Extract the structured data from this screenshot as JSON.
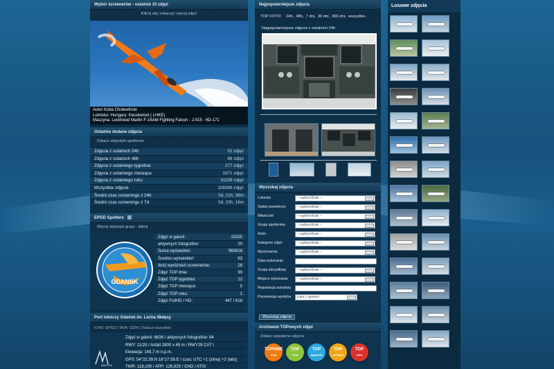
{
  "left_column": {
    "header": "Wybór screenerów - ostatnie 10 zdjęć",
    "sub": "Kliknij aby zobaczyć więcej zdjęć",
    "caption": {
      "author": "Autor Kuba Cholewiński",
      "airport": "Lotnisko: Hungary: Kecskemet ( LHKE)",
      "aircraft": "Maszyna: Lockheed Martin F-16AM Fighting Falcon - J-015 - 6D-171"
    },
    "stats": {
      "header": "Ostatnio dodane zdjęcia",
      "sub": "Zobacz statystyki spotterów",
      "rows": [
        {
          "label": "Zdjęcia z ostatnich 24h",
          "value": "52 zdjęć"
        },
        {
          "label": "Zdjęcia z ostatnich 48h",
          "value": "86 zdjęć"
        },
        {
          "label": "Zdjęcia z ostatniego tygodnia",
          "value": "277 zdjęć"
        },
        {
          "label": "Zdjęcia z ostatniego miesiąca",
          "value": "1871 zdjęć"
        },
        {
          "label": "Zdjęcia z ostatniego roku",
          "value": "31159 zdjęć"
        },
        {
          "label": "Wszystkie zdjęcia",
          "value": "108396 zdjęć"
        },
        {
          "label": "Średni czas screeningu z 24h",
          "value": "0d, 21h, 38m"
        },
        {
          "label": "Średni czas screeningu z 7d",
          "value": "0d, 23h, 16m"
        }
      ]
    },
    "spotters": {
      "header": "EPGD Spotters",
      "sub": "Więcej statystyk grupy - kliknij",
      "logo_text": "GDANSK",
      "rows": [
        {
          "label": "Zdjęć w galerii:",
          "value": "15325"
        },
        {
          "label": "aktywnych fotografów:",
          "value": "20"
        },
        {
          "label": "Suma wyświetleń:",
          "value": "960816"
        },
        {
          "label": "Średnio wyświetleń:",
          "value": "63"
        },
        {
          "label": "Ilość wyróżnień screenerów:",
          "value": "28"
        },
        {
          "label": "Zdjęć TOP dnia:",
          "value": "93"
        },
        {
          "label": "Zdjęć TOP tygodnia:",
          "value": "12"
        },
        {
          "label": "Zdjęć TOP miesiąca:",
          "value": "5"
        },
        {
          "label": "Zdjęć TOP roku:",
          "value": "1"
        },
        {
          "label": "Zdjęć FullHD / HD:",
          "value": "447 / 618"
        }
      ]
    },
    "airport": {
      "header": "Port lotniczy Gdańsk im. Lecha Wałęsy",
      "sub": "ICAO: EPGD / IATA: GDN | Zobacz wszystkie",
      "lines": [
        "Zdjęć w galerii: 6636 / aktywnych fotografów: 94",
        "RWY: 11/29 / Asfalt 2800 x 45 m / RWY29 CAT I",
        "Elewacja: 148,7 m n.p.m.",
        "GPS: 54°22.39.N 18°27.58.E / czas: UTC +1 (zima) +2 (lato)",
        "TWR: 118,100 / APP: 128,825 / GND / ATIS:"
      ],
      "logo_text": "WALESA"
    }
  },
  "middle_column": {
    "top_foto": {
      "label": "TOP FOTO:",
      "periods": [
        "24h,",
        "48h,",
        "7 dni,",
        "30 dni,",
        "365 dni,",
        "wszystkie."
      ]
    },
    "most_viewed_title": "Najpopularniejsze zdjęcia z ostatnich 24h",
    "search": {
      "header": "Wyszukaj zdjęcia",
      "placeholder": "-- wybierz/brak --",
      "fields": [
        {
          "label": "Lotnisko",
          "type": "select"
        },
        {
          "label": "Statek powietrzny",
          "type": "select"
        },
        {
          "label": "Właściciel",
          "type": "select"
        },
        {
          "label": "Grupa spotterska",
          "type": "select"
        },
        {
          "label": "Autor",
          "type": "select"
        },
        {
          "label": "Kategorie zdjęć",
          "type": "select"
        },
        {
          "label": "Wyróżnienia",
          "type": "select"
        },
        {
          "label": "Data wykonania",
          "type": "text"
        },
        {
          "label": "Grupa skrzydłowy",
          "type": "select"
        },
        {
          "label": "Miejsce wykonania",
          "type": "select"
        },
        {
          "label": "Rejestracja samolotu",
          "type": "text"
        },
        {
          "label": "Prezentacja wyników",
          "type": "prez"
        }
      ],
      "prez_value": "Lista z opisami",
      "button": "Wyszukaj zdjęcia"
    },
    "archive": {
      "header": "Archiwum TOPowych zdjęć",
      "sub": "Zobacz popularne zdjęcia",
      "badges": [
        {
          "top": "TOPOWE",
          "bottom": "dnia",
          "color": "#ef7a14"
        },
        {
          "top": "TOP",
          "bottom": "dnia",
          "color": "#8cc43c"
        },
        {
          "top": "TOP",
          "bottom": "tygodnia",
          "color": "#2eaadc"
        },
        {
          "top": "TOP",
          "bottom": "miesiąca",
          "color": "#f2a516"
        },
        {
          "top": "TOP",
          "bottom": "roku",
          "color": "#d9322a"
        }
      ]
    }
  },
  "right_column": {
    "header": "Losowe zdjęcia"
  }
}
